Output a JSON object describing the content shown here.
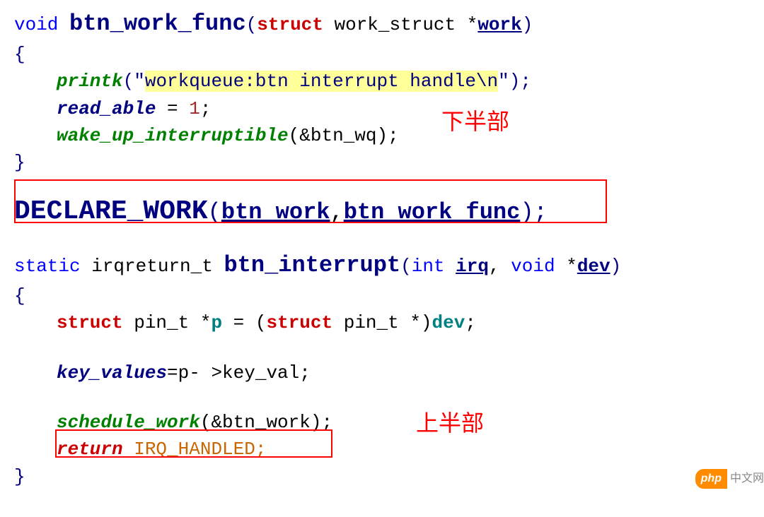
{
  "code": {
    "line1": {
      "void": "void ",
      "func": "btn_work_func",
      "open": "(",
      "struct": "struct",
      "type": " work_struct *",
      "param": "work",
      "close": ")"
    },
    "line2": "{",
    "line3": {
      "call": "printk",
      "open": "(\"",
      "str": "workqueue:btn interrupt handle\\n",
      "close": "\");"
    },
    "line4": {
      "var": "read_able",
      "rest": " = ",
      "num": "1",
      "semi": ";"
    },
    "line5": {
      "call": "wake_up_interruptible",
      "args": "(&btn_wq);"
    },
    "line6": "}",
    "line7": {
      "func": "DECLARE_WORK",
      "open": "(",
      "arg1": "btn_work",
      "comma": ",",
      "arg2": "btn_work_func",
      "close": ");"
    },
    "line8": {
      "static": "static",
      "rettype": " irqreturn_t ",
      "func": "btn_interrupt",
      "open": "(",
      "int": "int",
      "sp": " ",
      "irq": "irq",
      "comma": ", ",
      "void": "void",
      "star": " *",
      "dev": "dev",
      "close": ")"
    },
    "line9": "{",
    "line10": {
      "struct": "struct",
      "type": " pin_t *",
      "var": "p",
      "eq": " = (",
      "struct2": "struct",
      "type2": " pin_t *)",
      "dev": "dev",
      "semi": ";"
    },
    "line11": {
      "var": "key_values",
      "rest": "=p- >key_val;"
    },
    "line12": {
      "call": "schedule_work",
      "args": "(&btn_work);"
    },
    "line13": {
      "ret": "return",
      "val": " IRQ_HANDLED;"
    },
    "line14": "}"
  },
  "annotations": {
    "bottom_half": "下半部",
    "top_half": "上半部"
  },
  "watermark": {
    "badge": "php",
    "text": "中文网"
  }
}
